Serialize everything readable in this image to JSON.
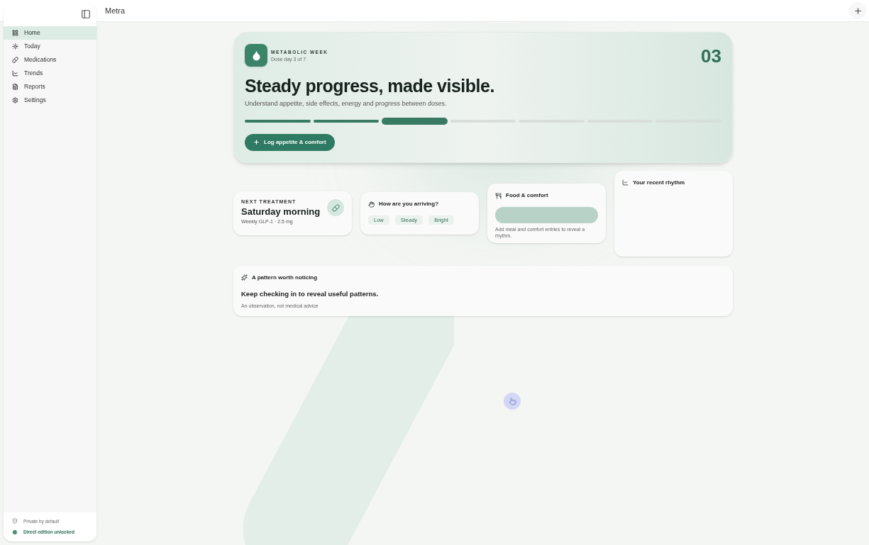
{
  "app": {
    "title": "Metra"
  },
  "sidebar": {
    "items": [
      {
        "label": "Home",
        "selected": true
      },
      {
        "label": "Today",
        "selected": false
      },
      {
        "label": "Medications",
        "selected": false
      },
      {
        "label": "Trends",
        "selected": false
      },
      {
        "label": "Reports",
        "selected": false
      },
      {
        "label": "Settings",
        "selected": false
      }
    ],
    "footer": [
      {
        "label": "Private by default",
        "kind": "shield"
      },
      {
        "label": "Direct edition unlocked",
        "kind": "check"
      }
    ]
  },
  "hero": {
    "eyebrow": "METABOLIC WEEK",
    "subtitle": "Dose day 3 of 7",
    "day_number": "03",
    "headline": "Steady progress, made visible.",
    "description": "Understand appetite, side effects, energy and progress between doses.",
    "segments": [
      {
        "kind": "done"
      },
      {
        "kind": "done"
      },
      {
        "kind": "current"
      },
      {
        "kind": "todo"
      },
      {
        "kind": "todo"
      },
      {
        "kind": "todo"
      },
      {
        "kind": "todo"
      }
    ],
    "button": "Log appetite & comfort"
  },
  "next_treatment": {
    "eyebrow": "NEXT TREATMENT",
    "title": "Saturday morning",
    "detail": "Weekly GLP-1 · 2.5 mg"
  },
  "arriving": {
    "title": "How are you arriving?",
    "options": [
      "Low",
      "Steady",
      "Bright"
    ]
  },
  "food": {
    "title": "Food & comfort",
    "note": "Add meal and comfort entries to reveal a rhythm."
  },
  "rhythm": {
    "title": "Your recent rhythm"
  },
  "pattern": {
    "title": "A pattern worth noticing",
    "message": "Keep checking in to reveal useful patterns.",
    "note": "An observation, not medical advice"
  }
}
